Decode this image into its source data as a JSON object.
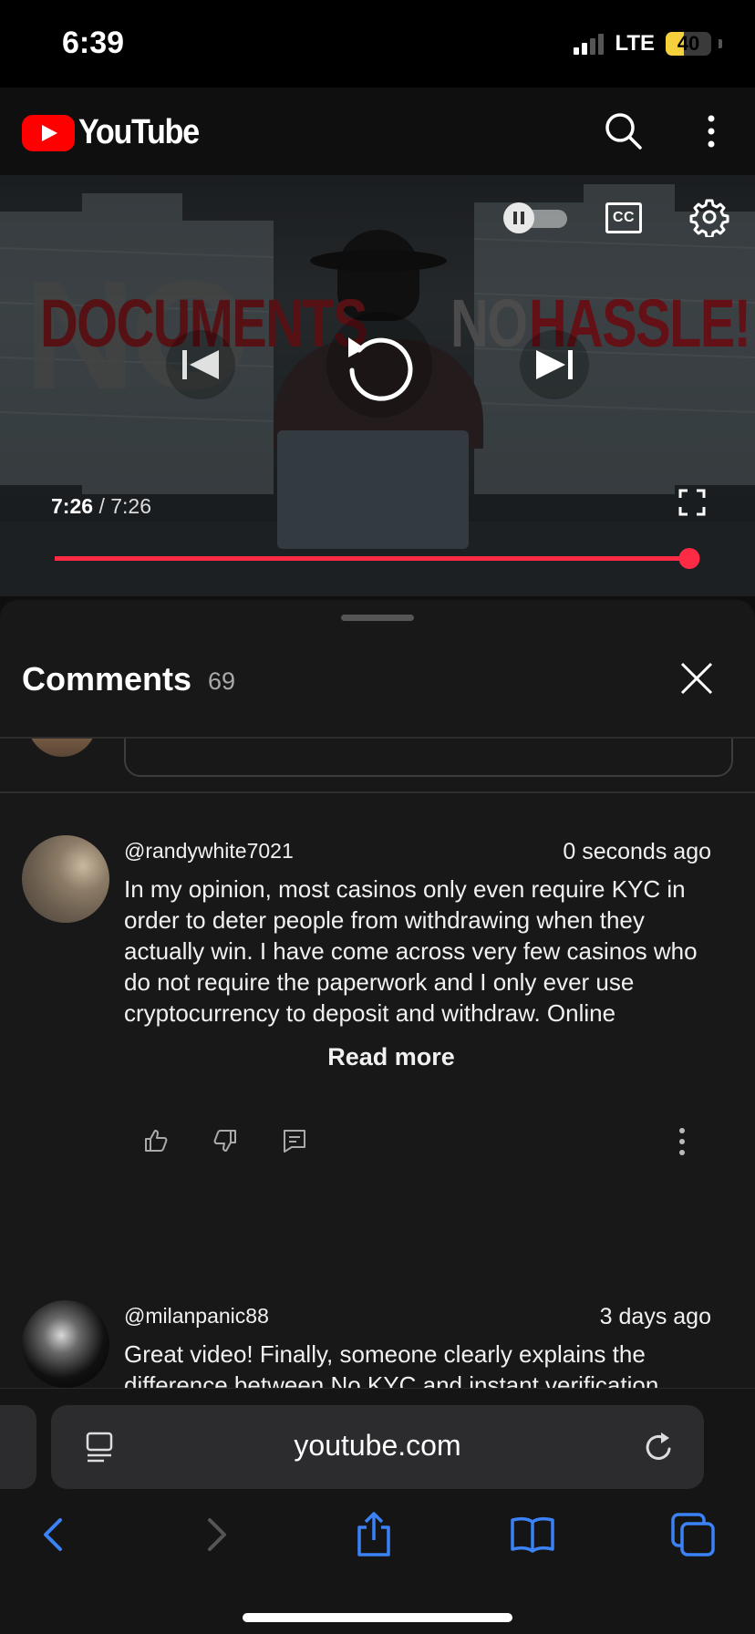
{
  "status_bar": {
    "time": "6:39",
    "network": "LTE",
    "battery_percent": "40",
    "battery_level": 0.4,
    "signal_bars": 2
  },
  "header": {
    "logo_text": "YouTube",
    "icons": [
      "search-icon",
      "more-vert-icon"
    ]
  },
  "player": {
    "thumbnail_words": {
      "no_large": "NO",
      "documents": "DOCUMENTS",
      "no_small": "NO",
      "hassle": "HASSLE!"
    },
    "cc_label": "CC",
    "time_current": "7:26",
    "time_separator": "/",
    "time_duration": "7:26",
    "progress": 1.0,
    "accent_color": "#ff2b44",
    "icons": [
      "autoplay-toggle-icon",
      "cc-icon",
      "gear-icon",
      "skip-previous-icon",
      "replay-icon",
      "skip-next-icon",
      "fullscreen-icon"
    ]
  },
  "comments": {
    "title": "Comments",
    "count": "69",
    "items": [
      {
        "author": "@randywhite7021",
        "time": "0 seconds ago",
        "text": "In my opinion, most casinos only even require KYC in order to deter people from withdrawing when they actually win. I have come across very few casinos who do not require the paperwork and I only ever use cryptocurrency to deposit and withdraw. Online",
        "read_more": "Read more"
      },
      {
        "author": "@milanpanic88",
        "time": "3 days ago",
        "text": "Great video! Finally, someone clearly explains the difference between No KYC and instant verification"
      }
    ]
  },
  "safari": {
    "url": "youtube.com",
    "icons": [
      "reader-icon",
      "reload-icon",
      "back-icon",
      "forward-icon",
      "share-icon",
      "bookmarks-icon",
      "tabs-icon"
    ]
  }
}
